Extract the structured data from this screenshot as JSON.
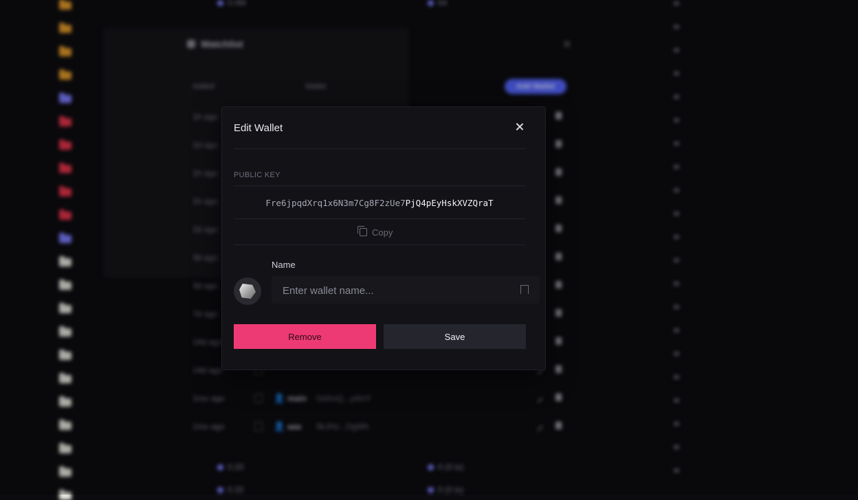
{
  "background": {
    "watchlist_title": "Watchlist",
    "add_wallet_label": "Add Wallet",
    "column_headers": [
      "Added",
      "Wallet"
    ],
    "rows": [
      {
        "age": "1h ago"
      },
      {
        "age": "1d ago"
      },
      {
        "age": "1h ago"
      },
      {
        "age": "1h ago"
      },
      {
        "age": "2d ago"
      },
      {
        "age": "3d ago"
      },
      {
        "age": "3d ago"
      },
      {
        "age": "7d ago"
      },
      {
        "age": "14d ago"
      },
      {
        "age": "14d ago"
      },
      {
        "age": "1mo ago",
        "emoji": "👤",
        "name": "main",
        "address": "GdXxQ...y4mY"
      },
      {
        "age": "1mo ago",
        "emoji": "👤",
        "name": "aaa",
        "address": "9kJHz...DgWh"
      }
    ],
    "top_values": [
      "0.0M",
      "64"
    ],
    "bottom_values": [
      {
        "left": "0.33",
        "right": "0 (0 tx)"
      },
      {
        "left": "0.33",
        "right": "0 (0 tx)"
      }
    ],
    "folder_colors": [
      "#e39a2a",
      "#e39a2a",
      "#e39a2a",
      "#e39a2a",
      "#7c7cff",
      "#e5334b",
      "#e5334b",
      "#e5334b",
      "#e5334b",
      "#e5334b",
      "#7c7cff",
      "#e8e8e0",
      "#e8e8e0",
      "#e8e8e0",
      "#e8e8e0",
      "#e8e8e0",
      "#e8e8e0",
      "#e8e8e0",
      "#e8e8e0",
      "#e8e8e0",
      "#e8e8e0",
      "#e8e8e0"
    ]
  },
  "modal": {
    "title": "Edit Wallet",
    "public_key_label": "PUBLIC KEY",
    "public_key_prefix": "Fre6jpqdXrq1x6N3m7Cg8F2zUe7",
    "public_key_suffix": "PjQ4pEyHskXVZQraT",
    "copy_label": "Copy",
    "name_label": "Name",
    "name_placeholder": "Enter wallet name...",
    "name_value": "",
    "remove_label": "Remove",
    "save_label": "Save",
    "colors": {
      "remove": "#ee3a74",
      "save": "#25252e"
    }
  }
}
